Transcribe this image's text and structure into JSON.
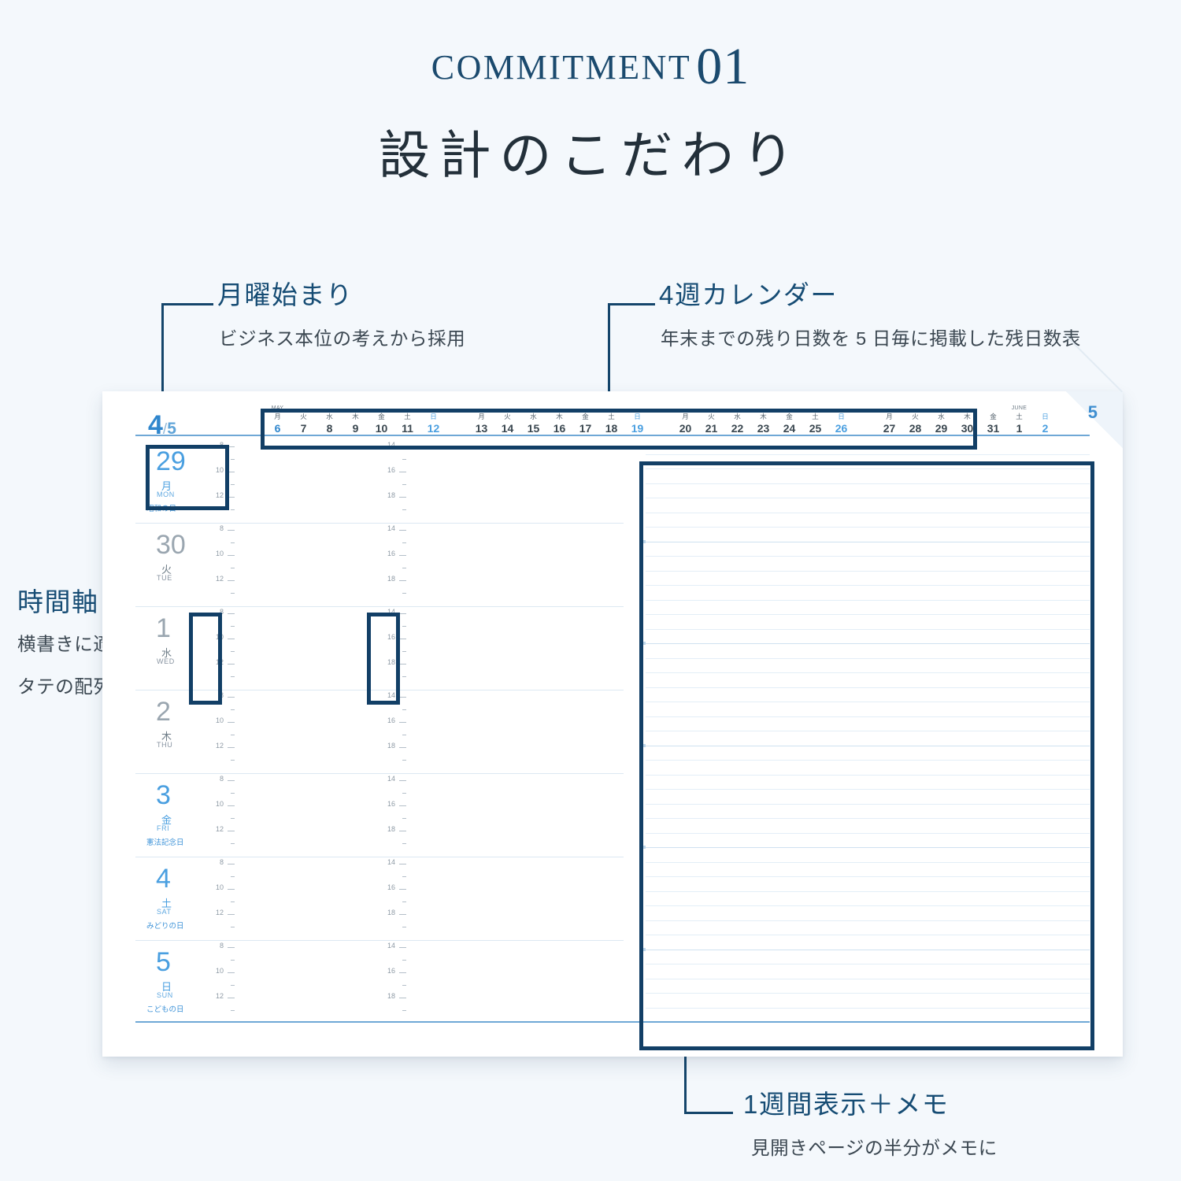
{
  "header": {
    "commitment_word": "COMMITMENT",
    "commitment_number": "01",
    "subtitle": "設計のこだわり"
  },
  "callouts": [
    {
      "id": "monday-start",
      "title": "月曜始まり",
      "desc": "ビジネス本位の考えから採用"
    },
    {
      "id": "four-week-calendar",
      "title": "4週カレンダー",
      "desc": "年末までの残り日数を 5 日毎に掲載した残日数表"
    },
    {
      "id": "time-axis",
      "title": "時間軸",
      "desc_line1": "横書きに適した",
      "desc_line2": "タテの配列"
    },
    {
      "id": "week-view-memo",
      "title": "1週間表示＋メモ",
      "desc": "見開きページの半分がメモに"
    }
  ],
  "planner": {
    "page_number": "5",
    "month_current": "4",
    "month_slash": "/",
    "month_next": "5",
    "calendar_strip": {
      "groups": [
        {
          "month_abbr": "MAY",
          "cells": [
            {
              "weekday": "月",
              "day": "6",
              "type": "first"
            },
            {
              "weekday": "火",
              "day": "7",
              "type": "normal"
            },
            {
              "weekday": "水",
              "day": "8",
              "type": "normal"
            },
            {
              "weekday": "木",
              "day": "9",
              "type": "normal"
            },
            {
              "weekday": "金",
              "day": "10",
              "type": "normal"
            },
            {
              "weekday": "土",
              "day": "11",
              "type": "normal"
            },
            {
              "weekday": "日",
              "day": "12",
              "type": "sun"
            }
          ]
        },
        {
          "month_abbr": "",
          "cells": [
            {
              "weekday": "月",
              "day": "13",
              "type": "normal"
            },
            {
              "weekday": "火",
              "day": "14",
              "type": "normal"
            },
            {
              "weekday": "水",
              "day": "15",
              "type": "normal"
            },
            {
              "weekday": "木",
              "day": "16",
              "type": "normal"
            },
            {
              "weekday": "金",
              "day": "17",
              "type": "normal"
            },
            {
              "weekday": "土",
              "day": "18",
              "type": "normal"
            },
            {
              "weekday": "日",
              "day": "19",
              "type": "sun"
            }
          ]
        },
        {
          "month_abbr": "",
          "cells": [
            {
              "weekday": "月",
              "day": "20",
              "type": "normal"
            },
            {
              "weekday": "火",
              "day": "21",
              "type": "normal"
            },
            {
              "weekday": "水",
              "day": "22",
              "type": "normal"
            },
            {
              "weekday": "木",
              "day": "23",
              "type": "normal"
            },
            {
              "weekday": "金",
              "day": "24",
              "type": "normal"
            },
            {
              "weekday": "土",
              "day": "25",
              "type": "normal"
            },
            {
              "weekday": "日",
              "day": "26",
              "type": "sun"
            }
          ]
        },
        {
          "month_abbr": "",
          "cells": [
            {
              "weekday": "月",
              "day": "27",
              "type": "normal"
            },
            {
              "weekday": "火",
              "day": "28",
              "type": "normal"
            },
            {
              "weekday": "水",
              "day": "29",
              "type": "normal"
            },
            {
              "weekday": "木",
              "day": "30",
              "type": "normal"
            },
            {
              "weekday": "金",
              "day": "31",
              "type": "normal"
            },
            {
              "weekday": "土",
              "day": "1",
              "type": "normal",
              "month_abbr": "JUNE"
            },
            {
              "weekday": "日",
              "day": "2",
              "type": "sun"
            }
          ]
        }
      ]
    },
    "days": [
      {
        "num": "29",
        "kanji": "月",
        "eng": "MON",
        "holiday": "昭和の日",
        "accent": true
      },
      {
        "num": "30",
        "kanji": "火",
        "eng": "TUE",
        "holiday": "",
        "accent": false
      },
      {
        "num": "1",
        "kanji": "水",
        "eng": "WED",
        "holiday": "",
        "accent": false
      },
      {
        "num": "2",
        "kanji": "木",
        "eng": "THU",
        "holiday": "",
        "accent": false
      },
      {
        "num": "3",
        "kanji": "金",
        "eng": "FRI",
        "holiday": "憲法記念日",
        "accent": true
      },
      {
        "num": "4",
        "kanji": "土",
        "eng": "SAT",
        "holiday": "みどりの日",
        "accent": true
      },
      {
        "num": "5",
        "kanji": "日",
        "eng": "SUN",
        "holiday": "こどもの日",
        "accent": true
      }
    ],
    "time_axis": {
      "morning_labels": [
        "8",
        "10",
        "12"
      ],
      "afternoon_labels": [
        "14",
        "16",
        "18"
      ]
    }
  },
  "colors": {
    "background": "#f4f8fc",
    "brand_navy": "#164c74",
    "highlight_navy": "#123f66",
    "accent_blue": "#2f86cd",
    "text_dark": "#23303a"
  }
}
